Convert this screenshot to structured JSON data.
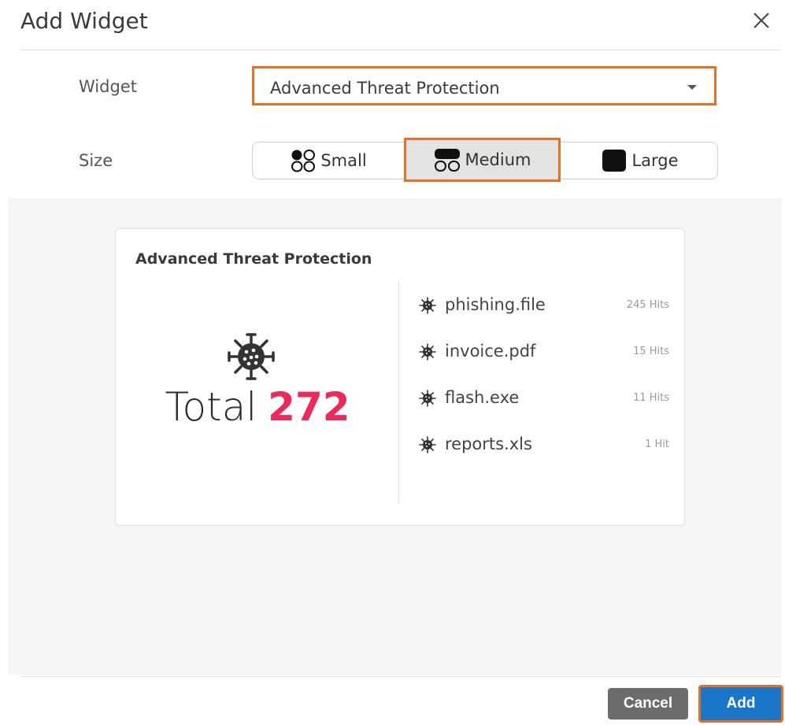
{
  "dialog": {
    "title": "Add Widget",
    "close_icon": "close-icon"
  },
  "form": {
    "widget_label": "Widget",
    "widget_value": "Advanced Threat Protection",
    "size_label": "Size",
    "size_options": [
      {
        "label": "Small",
        "icon": "size-small-icon",
        "selected": false
      },
      {
        "label": "Medium",
        "icon": "size-medium-icon",
        "selected": true
      },
      {
        "label": "Large",
        "icon": "size-large-icon",
        "selected": false
      }
    ],
    "highlight_color": "#e8701e"
  },
  "preview": {
    "title": "Advanced Threat Protection",
    "total_label": "Total",
    "total_value": "272",
    "total_color": "#f0285a",
    "threats": [
      {
        "name": "phishing.file",
        "hits": "245 Hits",
        "icon": "virus-icon"
      },
      {
        "name": "invoice.pdf",
        "hits": "15 Hits",
        "icon": "virus-icon"
      },
      {
        "name": "flash.exe",
        "hits": "11 Hits",
        "icon": "virus-icon"
      },
      {
        "name": "reports.xls",
        "hits": "1 Hit",
        "icon": "virus-icon"
      }
    ]
  },
  "footer": {
    "cancel_label": "Cancel",
    "add_label": "Add",
    "add_color": "#1976c9"
  }
}
